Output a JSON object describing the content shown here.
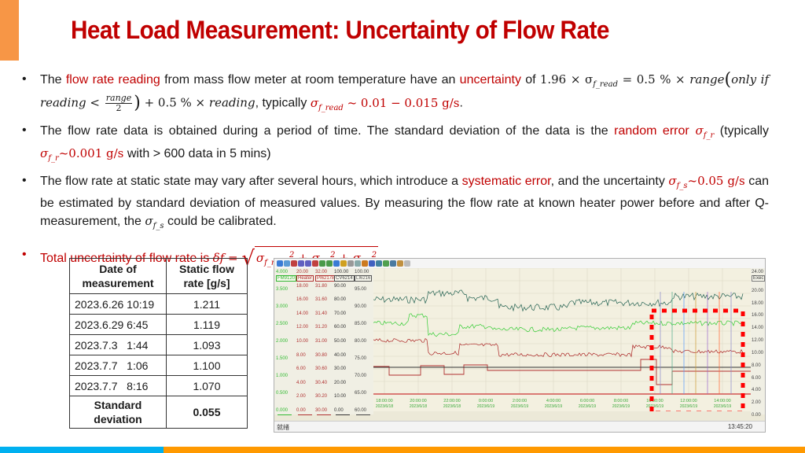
{
  "slide": {
    "title": "Heat Load Measurement: Uncertainty of Flow Rate",
    "colors": {
      "accent": "#f79646",
      "title": "#c00000",
      "highlight": "#c00000",
      "footer_blue": "#00b0f0",
      "footer_orange": "#ff9900"
    }
  },
  "bullets": [
    {
      "marker": "•",
      "t1": "The ",
      "h1": "flow rate reading",
      "t2": " from mass flow meter at room temperature have an ",
      "h2": "uncertainty",
      "t3": " of ",
      "f1": "1.96 × σ",
      "f1_sub": "f_read",
      "f2": " = 0.5 % × ",
      "f3": "range",
      "paren_open": "(",
      "f4": "only if reading < ",
      "frac_num": "range",
      "frac_den": "2",
      "paren_close": ")",
      "f5": " + 0.5 % × ",
      "f6": "reading",
      "t4": ", typically ",
      "h3": "σ",
      "h3_sub": "f_read",
      "h3_rest": " ~ 0.01 − 0.015 g/s",
      "t5": "."
    },
    {
      "marker": "•",
      "t1": "The flow rate data is obtained during a period of time. The standard deviation of the data is the ",
      "h1": "random error",
      "h1_sym": " σ",
      "h1_sub": "f_r",
      "t2": " (typically ",
      "h2": "σ",
      "h2_sub": "f_r",
      "h2_rest": "~0.001 g/s",
      "t3": " with > 600 data in 5 mins)"
    },
    {
      "marker": "•",
      "t1": "The flow rate at static state may vary after several hours, which introduce a ",
      "h1": "systematic error",
      "t2": ", and the uncertainty ",
      "h2": "σ",
      "h2_sub": "f_s",
      "h2_rest": "~0.05 g/s",
      "t3": " can be estimated by standard deviation of measured values. By measuring the flow rate at known heater power before and after Q-measurement, the ",
      "s1": "σ",
      "s1_sub": "f_s",
      "t4": " could be calibrated."
    },
    {
      "marker": "•",
      "t1": "Total uncertainty of flow rate is ",
      "f1": "δf = ",
      "r1": "σ",
      "r1_sub": "f_read",
      "r1_sup": "2",
      "r2": " + σ",
      "r2_sub": "f_r",
      "r2_sup": "2",
      "r3": " + σ",
      "r3_sub": "f_s",
      "r3_sup": "2"
    }
  ],
  "table": {
    "headers": [
      "Date of measurement",
      "Static flow rate [g/s]"
    ],
    "rows": [
      {
        "date": "2023.6.26 10:19",
        "value": "1.211"
      },
      {
        "date": "2023.6.29 6:45",
        "value": "1.119"
      },
      {
        "date": "2023.7.3   1:44",
        "value": "1.093"
      },
      {
        "date": "2023.7.7   1:06",
        "value": "1.100"
      },
      {
        "date": "2023.7.7   8:16",
        "value": "1.070"
      }
    ],
    "footer_label": "Standard deviation",
    "footer_value": "0.055"
  },
  "screenshot": {
    "channel_tags": [
      "FM9120",
      "Heater",
      "PI6217B",
      "CV6214",
      "LI6216"
    ],
    "tag_colors": [
      "#2fb52f",
      "#b03030",
      "#b03030",
      "#444444",
      "#555555"
    ],
    "axes": [
      {
        "color": "#33bb33",
        "ticks": [
          "4.000",
          "3.500",
          "3.000",
          "2.500",
          "2.000",
          "1.500",
          "1.000",
          "0.500",
          "0.000"
        ]
      },
      {
        "color": "#b03030",
        "ticks": [
          "20.00",
          "18.00",
          "16.00",
          "14.00",
          "12.00",
          "10.00",
          "8.00",
          "6.00",
          "4.00",
          "2.00",
          "0.00"
        ]
      },
      {
        "color": "#b03030",
        "ticks": [
          "32.00",
          "31.80",
          "31.60",
          "31.40",
          "31.20",
          "31.00",
          "30.80",
          "30.60",
          "30.40",
          "30.20",
          "30.00"
        ]
      },
      {
        "color": "#333333",
        "ticks": [
          "100.00",
          "90.00",
          "80.00",
          "70.00",
          "60.00",
          "50.00",
          "40.00",
          "30.00",
          "20.00",
          "10.00",
          "0.00"
        ]
      },
      {
        "color": "#444444",
        "ticks": [
          "100.00",
          "95.00",
          "90.00",
          "85.00",
          "80.00",
          "75.00",
          "70.00",
          "65.00",
          "60.00"
        ]
      }
    ],
    "right_axis": [
      "24.00",
      "20.00",
      "18.00",
      "16.00",
      "14.00",
      "12.00",
      "10.00",
      "8.00",
      "6.00",
      "4.00",
      "2.00",
      "0.00"
    ],
    "right_axis_button": "Exec",
    "time_ticks": [
      {
        "time": "18:00:00",
        "date": "2023/6/18"
      },
      {
        "time": "20:00:00",
        "date": "2023/6/18"
      },
      {
        "time": "22:00:00",
        "date": "2023/6/18"
      },
      {
        "time": "0:00:00",
        "date": "2023/6/19"
      },
      {
        "time": "2:00:00",
        "date": "2023/6/19"
      },
      {
        "time": "4:00:00",
        "date": "2023/6/19"
      },
      {
        "time": "6:00:00",
        "date": "2023/6/19"
      },
      {
        "time": "8:00:00",
        "date": "2023/6/19"
      },
      {
        "time": "10:00:00",
        "date": "2023/6/19"
      },
      {
        "time": "12:00:00",
        "date": "2023/6/19"
      },
      {
        "time": "14:00:00",
        "date": "2023/6/19"
      }
    ],
    "status_text": "就绪",
    "clock": "13:45:20",
    "highlight_color": "#ff0000"
  }
}
